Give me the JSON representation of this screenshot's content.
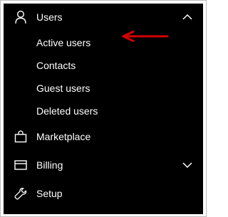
{
  "nav": {
    "users": {
      "label": "Users",
      "icon": "person-icon",
      "expanded": true
    },
    "sub_items": [
      {
        "label": "Active users"
      },
      {
        "label": "Contacts"
      },
      {
        "label": "Guest users"
      },
      {
        "label": "Deleted users"
      }
    ],
    "marketplace": {
      "label": "Marketplace",
      "icon": "shopping-bag-icon"
    },
    "billing": {
      "label": "Billing",
      "icon": "credit-card-icon",
      "expanded": false
    },
    "setup": {
      "label": "Setup",
      "icon": "wrench-icon"
    }
  },
  "colors": {
    "background": "#000000",
    "text": "#ffffff",
    "annotation_arrow": "#d40000",
    "frame_border": "#bdbdbd"
  }
}
